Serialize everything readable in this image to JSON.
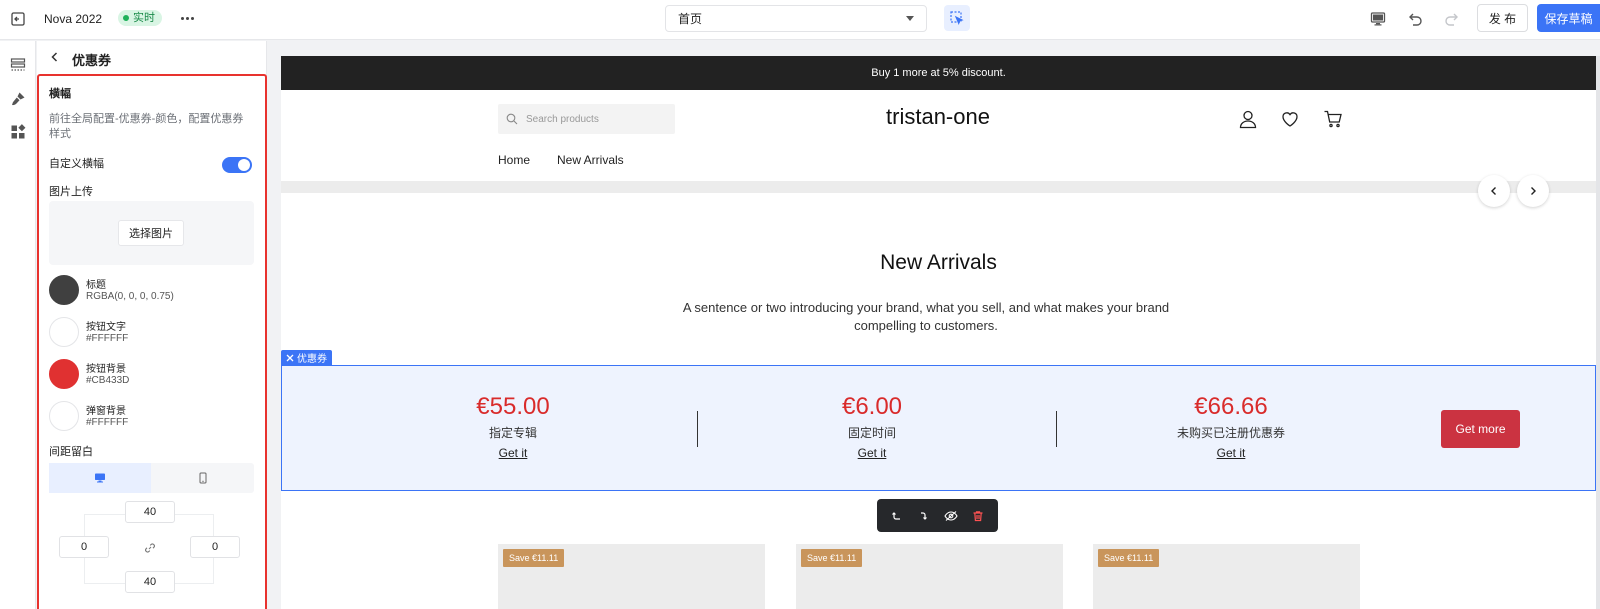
{
  "topbar": {
    "title": "Nova 2022",
    "status_badge": "实时",
    "page_select": "首页",
    "publish_label": "发 布",
    "save_draft_label": "保存草稿"
  },
  "panel": {
    "title": "优惠券",
    "banner_label": "横幅",
    "banner_desc": "前往全局配置-优惠券-颜色，配置优惠券样式",
    "custom_banner_label": "自定义横幅",
    "custom_banner_on": true,
    "image_upload_label": "图片上传",
    "choose_image_label": "选择图片",
    "colors": [
      {
        "name": "标题",
        "value": "RGBA(0, 0, 0, 0.75)",
        "swatch": "#404040"
      },
      {
        "name": "按钮文字",
        "value": "#FFFFFF",
        "swatch": "#FFFFFF"
      },
      {
        "name": "按钮背景",
        "value": "#CB433D",
        "swatch": "#E03131"
      },
      {
        "name": "弹窗背景",
        "value": "#FFFFFF",
        "swatch": "#FFFFFF"
      }
    ],
    "spacing_label": "间距留白",
    "spacing": {
      "top": "40",
      "left": "0",
      "right": "0",
      "bottom": "40"
    }
  },
  "store": {
    "announcement": "Buy 1 more at 5% discount.",
    "search_placeholder": "Search products",
    "brand": "tristan-one",
    "nav": [
      "Home",
      "New Arrivals"
    ],
    "section_title": "New Arrivals",
    "section_subtitle": "A sentence or two introducing your brand, what you sell, and what makes your brand compelling to customers.",
    "coupon_tag": "优惠券",
    "coupons": [
      {
        "price": "€55.00",
        "name": "指定专辑",
        "link": "Get it"
      },
      {
        "price": "€6.00",
        "name": "固定时间",
        "link": "Get it"
      },
      {
        "price": "€66.66",
        "name": "未购买已注册优惠券",
        "link": "Get it"
      }
    ],
    "get_more_label": "Get more",
    "products": [
      {
        "badge": "Save €11.11"
      },
      {
        "badge": "Save €11.11"
      },
      {
        "badge": "Save €11.11"
      }
    ]
  },
  "colors": {
    "accent": "#3B74F6",
    "danger": "#E8322E",
    "coupon_price": "#D92B2B",
    "get_more_bg": "#CB3341",
    "badge_bg": "#C9955B"
  }
}
